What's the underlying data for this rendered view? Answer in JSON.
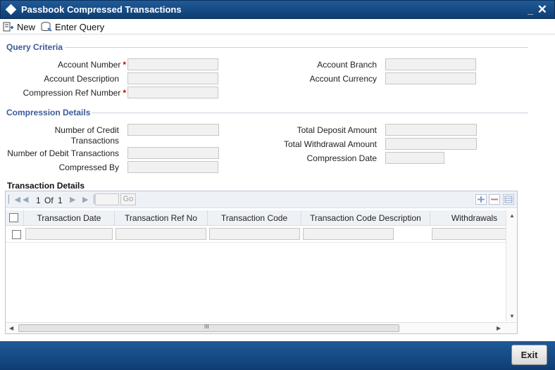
{
  "window": {
    "title": "Passbook Compressed Transactions"
  },
  "toolbar": {
    "new_label": "New",
    "enter_query_label": "Enter Query"
  },
  "query_criteria": {
    "title": "Query Criteria",
    "account_number_label": "Account Number",
    "account_description_label": "Account Description",
    "compression_ref_label": "Compression Ref Number",
    "account_branch_label": "Account Branch",
    "account_currency_label": "Account Currency",
    "required_mark": "*"
  },
  "compression_details": {
    "title": "Compression Details",
    "num_credit_label": "Number of Credit Transactions",
    "num_debit_label": "Number of Debit Transactions",
    "compressed_by_label": "Compressed By",
    "total_deposit_label": "Total Deposit Amount",
    "total_withdrawal_label": "Total Withdrawal Amount",
    "compression_date_label": "Compression Date"
  },
  "transaction_details": {
    "title": "Transaction Details",
    "pager": {
      "current": "1",
      "of_label": "Of",
      "total": "1",
      "go_label": "Go"
    },
    "columns": [
      "Transaction Date",
      "Transaction Ref No",
      "Transaction Code",
      "Transaction Code Description",
      "Withdrawals"
    ],
    "hscroll_grip": "III"
  },
  "footer": {
    "exit_label": "Exit"
  }
}
